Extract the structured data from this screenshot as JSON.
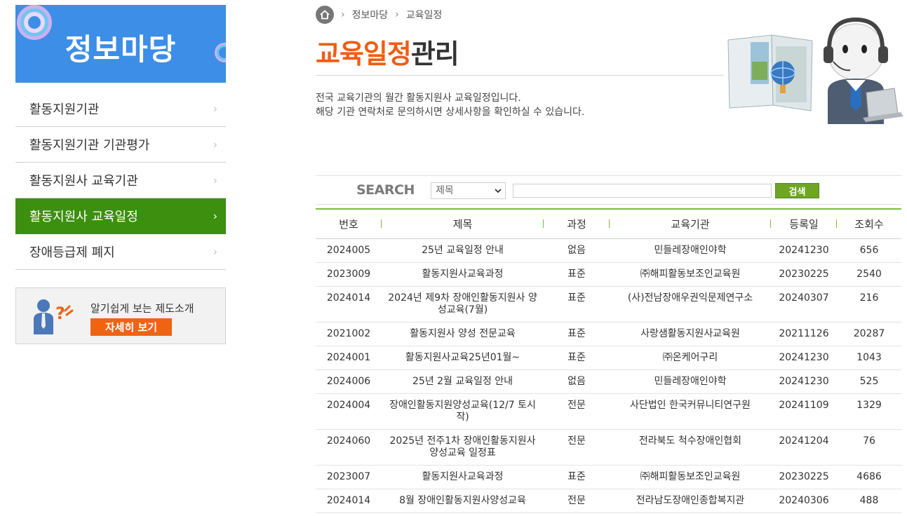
{
  "sidebar": {
    "banner_title": "정보마당",
    "menu": [
      {
        "label": "활동지원기관",
        "active": false
      },
      {
        "label": "활동지원기관 기관평가",
        "active": false
      },
      {
        "label": "활동지원사 교육기관",
        "active": false
      },
      {
        "label": "활동지원사 교육일정",
        "active": true
      },
      {
        "label": "장애등급제 폐지",
        "active": false
      }
    ],
    "menu_chevron": "›",
    "promo": {
      "text": "알기쉽게 보는 제도소개",
      "button": "자세히 보기"
    }
  },
  "breadcrumb": {
    "items": [
      "정보마당",
      "교육일정"
    ],
    "separator": "›"
  },
  "page": {
    "title_highlight": "교육일정",
    "title_rest": "관리",
    "desc_line1": "전국 교육기관의 월간 활동지원사 교육일정입니다.",
    "desc_line2": "해당 기관 연락처로 문의하시면 상세사항을 확인하실 수 있습니다."
  },
  "search": {
    "label": "SEARCH",
    "select_value": "제목",
    "caret": "⌄",
    "input_value": "",
    "button": "검색"
  },
  "table": {
    "headers": [
      "번호",
      "제목",
      "과정",
      "교육기관",
      "등록일",
      "조회수"
    ],
    "rows": [
      [
        "2024005",
        "25년 교육일정 안내",
        "없음",
        "민들레장애인야학",
        "20241230",
        "656"
      ],
      [
        "2023009",
        "활동지원사교육과정",
        "표준",
        "㈜해피활동보조인교육원",
        "20230225",
        "2540"
      ],
      [
        "2024014",
        "2024년 제9차 장애인활동지원사 양성교육(7월)",
        "표준",
        "(사)전남장애우권익문제연구소",
        "20240307",
        "216"
      ],
      [
        "2021002",
        "활동지원사 양성 전문교육",
        "표준",
        "사랑샘활동지원사교육원",
        "20211126",
        "20287"
      ],
      [
        "2024001",
        "활동지원사교육25년01월~",
        "표준",
        "㈜온케어구리",
        "20241230",
        "1043"
      ],
      [
        "2024006",
        "25년 2월 교육일정 안내",
        "없음",
        "민들레장애인야학",
        "20241230",
        "525"
      ],
      [
        "2024004",
        "장애인활동지원양성교육(12/7 토시작)",
        "전문",
        "사단법인 한국커뮤니티연구원",
        "20241109",
        "1329"
      ],
      [
        "2024060",
        "2025년 전주1차 장애인활동지원사 양성교육 일정표",
        "전문",
        "전라북도 척수장애인협회",
        "20241204",
        "76"
      ],
      [
        "2023007",
        "활동지원사교육과정",
        "표준",
        "㈜해피활동보조인교육원",
        "20230225",
        "4686"
      ],
      [
        "2024014",
        "8월 장애인활동지원사양성교육",
        "전문",
        "전라남도장애인종합복지관",
        "20240306",
        "488"
      ]
    ]
  },
  "colors": {
    "accent_green": "#3d8f0f",
    "title_orange": "#ef5d14",
    "banner_blue": "#3d8ee6",
    "table_line": "#7cbd3a"
  },
  "icons": [
    "home-icon",
    "chevron-right-icon",
    "person-question-icon",
    "mascot-illustration"
  ]
}
